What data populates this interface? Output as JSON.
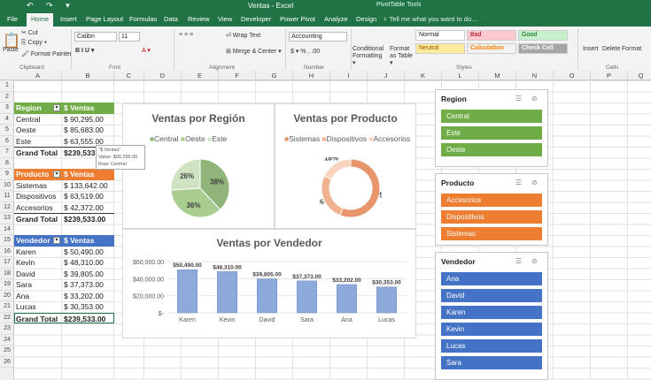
{
  "app": {
    "title": "Ventas - Excel",
    "context_tab": "PivotTable Tools",
    "qat": "↶ ↷ ▾"
  },
  "tabs": [
    "File",
    "Home",
    "Insert",
    "Page Layout",
    "Formulas",
    "Data",
    "Review",
    "View",
    "Developer",
    "Power Pivot",
    "Analyze",
    "Design"
  ],
  "tell_me": "♀ Tell me what you want to do...",
  "ribbon": {
    "clipboard": {
      "paste": "Paste",
      "cut": "✂ Cut",
      "copy": "⎘ Copy ▾",
      "painter": "🖌 Format Painter",
      "group": "Clipboard"
    },
    "font": {
      "name": "Calibri",
      "size": "11",
      "group": "Font",
      "styles": "B I U ▾"
    },
    "alignment": {
      "wrap": "⏎ Wrap Text",
      "merge": "⊞ Merge & Center ▾",
      "group": "Alignment"
    },
    "number": {
      "format": "Accounting",
      "group": "Number",
      "symbols": "$ ▾ % , .00"
    },
    "styles": {
      "conditional": "Conditional Formatting ▾",
      "format_table": "Format as Table ▾",
      "normal": "Normal",
      "bad": "Bad",
      "good": "Good",
      "neutral": "Neutral",
      "calculation": "Calculation",
      "check": "Check Cell",
      "group": "Styles"
    },
    "cells": {
      "insert": "Insert",
      "delete": "Delete",
      "format": "Format",
      "group": "Cells"
    }
  },
  "columns": [
    "A",
    "B",
    "C",
    "D",
    "E",
    "F",
    "G",
    "H",
    "I",
    "J",
    "K",
    "L",
    "M",
    "N",
    "O",
    "P",
    "Q"
  ],
  "rows": [
    "1",
    "2",
    "3",
    "4",
    "5",
    "6",
    "7",
    "8",
    "9",
    "10",
    "11",
    "12",
    "13",
    "14",
    "15",
    "16",
    "17",
    "18",
    "19",
    "20",
    "21",
    "22",
    "23",
    "24",
    "25",
    "26"
  ],
  "pivots": {
    "region": {
      "h1": "Region",
      "h2": "$ Ventas",
      "rows": [
        [
          "Central",
          "$  90,295.00"
        ],
        [
          "Oeste",
          "$  85,683.00"
        ],
        [
          "Este",
          "$  63,555.00"
        ]
      ],
      "total": [
        "Grand Total",
        "$239,533.00"
      ]
    },
    "producto": {
      "h1": "Producto",
      "h2": "$ Ventas",
      "rows": [
        [
          "Sistemas",
          "$ 133,642.00"
        ],
        [
          "Dispositivos",
          "$  63,519.00"
        ],
        [
          "Accesorios",
          "$  42,372.00"
        ]
      ],
      "total": [
        "Grand Total",
        "$239,533.00"
      ]
    },
    "vendedor": {
      "h1": "Vendedor",
      "h2": "$ Ventas",
      "rows": [
        [
          "Karen",
          "$  50,490.00"
        ],
        [
          "Kevin",
          "$  48,310.00"
        ],
        [
          "David",
          "$  39,805.00"
        ],
        [
          "Sara",
          "$  37,373.00"
        ],
        [
          "Ana",
          "$  33,202.00"
        ],
        [
          "Lucas",
          "$  30,353.00"
        ]
      ],
      "total": [
        "Grand Total",
        "$239,533.00"
      ]
    }
  },
  "tooltip": {
    "l1": "\"$ Ventas\"",
    "l2": "Value: $90,295.00",
    "l3": "Row: Central"
  },
  "charts": [
    {
      "type": "pie",
      "title": "Ventas por Región",
      "categories": [
        "Central",
        "Oeste",
        "Este"
      ],
      "values": [
        38,
        36,
        26
      ],
      "labels": [
        "38%",
        "36%",
        "26%"
      ],
      "colors": [
        "#8fb57a",
        "#a9cc91",
        "#cfe3c3"
      ]
    },
    {
      "type": "pie",
      "title": "Ventas por Producto",
      "categories": [
        "Sistemas",
        "Dispositivos",
        "Accesorios"
      ],
      "values": [
        56,
        26,
        18
      ],
      "labels": [
        "56%",
        "26%",
        "18%"
      ],
      "colors": [
        "#e8956b",
        "#f0b291",
        "#f8d3c0"
      ]
    },
    {
      "type": "bar",
      "title": "Ventas por Vendedor",
      "categories": [
        "Karen",
        "Kevin",
        "David",
        "Sara",
        "Ana",
        "Lucas"
      ],
      "values": [
        50490,
        48310,
        39805,
        37373,
        33202,
        30353
      ],
      "labels": [
        "$50,490.00",
        "$48,310.00",
        "$39,805.00",
        "$37,373.00",
        "$33,202.00",
        "$30,353.00"
      ],
      "yticks": [
        "$60,000.00",
        "$40,000.00",
        "$20,000.00",
        "$-"
      ],
      "ylim": [
        0,
        60000
      ],
      "color": "#8eaadb"
    }
  ],
  "chart_data": [
    {
      "type": "pie",
      "title": "Ventas por Región",
      "categories": [
        "Central",
        "Oeste",
        "Este"
      ],
      "values": [
        38,
        36,
        26
      ]
    },
    {
      "type": "pie",
      "title": "Ventas por Producto",
      "categories": [
        "Sistemas",
        "Dispositivos",
        "Accesorios"
      ],
      "values": [
        56,
        26,
        18
      ]
    },
    {
      "type": "bar",
      "title": "Ventas por Vendedor",
      "categories": [
        "Karen",
        "Kevin",
        "David",
        "Sara",
        "Ana",
        "Lucas"
      ],
      "values": [
        50490,
        48310,
        39805,
        37373,
        33202,
        30353
      ],
      "ylim": [
        0,
        60000
      ]
    }
  ],
  "slicers": [
    {
      "title": "Region",
      "items": [
        "Central",
        "Este",
        "Oeste"
      ],
      "color": "#70ad47"
    },
    {
      "title": "Producto",
      "items": [
        "Accesorios",
        "Dispositivos",
        "Sistemas"
      ],
      "color": "#ed7d31"
    },
    {
      "title": "Vendedor",
      "items": [
        "Ana",
        "David",
        "Karen",
        "Kevin",
        "Lucas",
        "Sara"
      ],
      "color": "#4472c4"
    }
  ]
}
